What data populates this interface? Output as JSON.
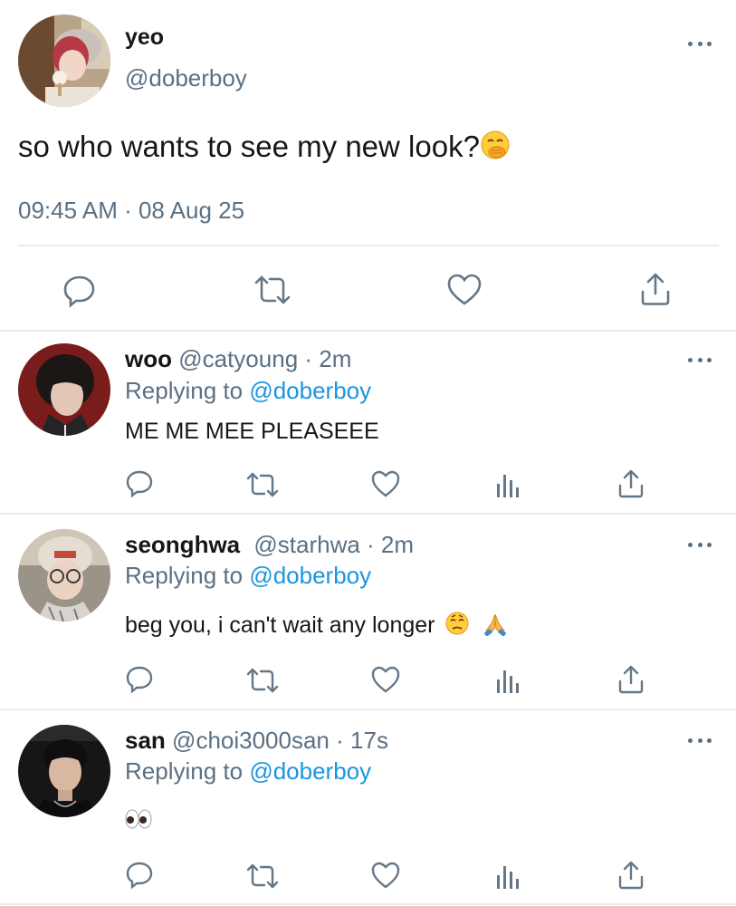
{
  "main_tweet": {
    "display_name": "yeo",
    "handle": "@doberboy",
    "text": "so who wants to see my new look?",
    "timestamp": "09:45 AM · 08 Aug 25",
    "more_icon": "more-horizontal-icon",
    "actions": [
      "reply-icon",
      "retweet-icon",
      "like-icon",
      "share-icon"
    ]
  },
  "replies": [
    {
      "display_name": "woo",
      "handle": "@catyoung",
      "time": "· 2m",
      "replying_label": "Replying to",
      "replying_handle": "@doberboy",
      "text": "ME ME MEE PLEASEEE"
    },
    {
      "display_name": "seonghwa",
      "handle": "@starhwa",
      "time": "· 2m",
      "replying_label": "Replying to",
      "replying_handle": "@doberboy",
      "text": "beg you, i can't wait any longer"
    },
    {
      "display_name": "san",
      "handle": "@choi3000san",
      "time": "· 17s",
      "replying_label": "Replying to",
      "replying_handle": "@doberboy",
      "text": ""
    }
  ],
  "reply_actions": [
    "reply-icon",
    "retweet-icon",
    "like-icon",
    "analytics-icon",
    "share-icon"
  ],
  "colors": {
    "text": "#14171a",
    "secondary": "#5b7083",
    "link": "#1b95e0",
    "icon": "#657786",
    "divider": "#e8ecef"
  }
}
